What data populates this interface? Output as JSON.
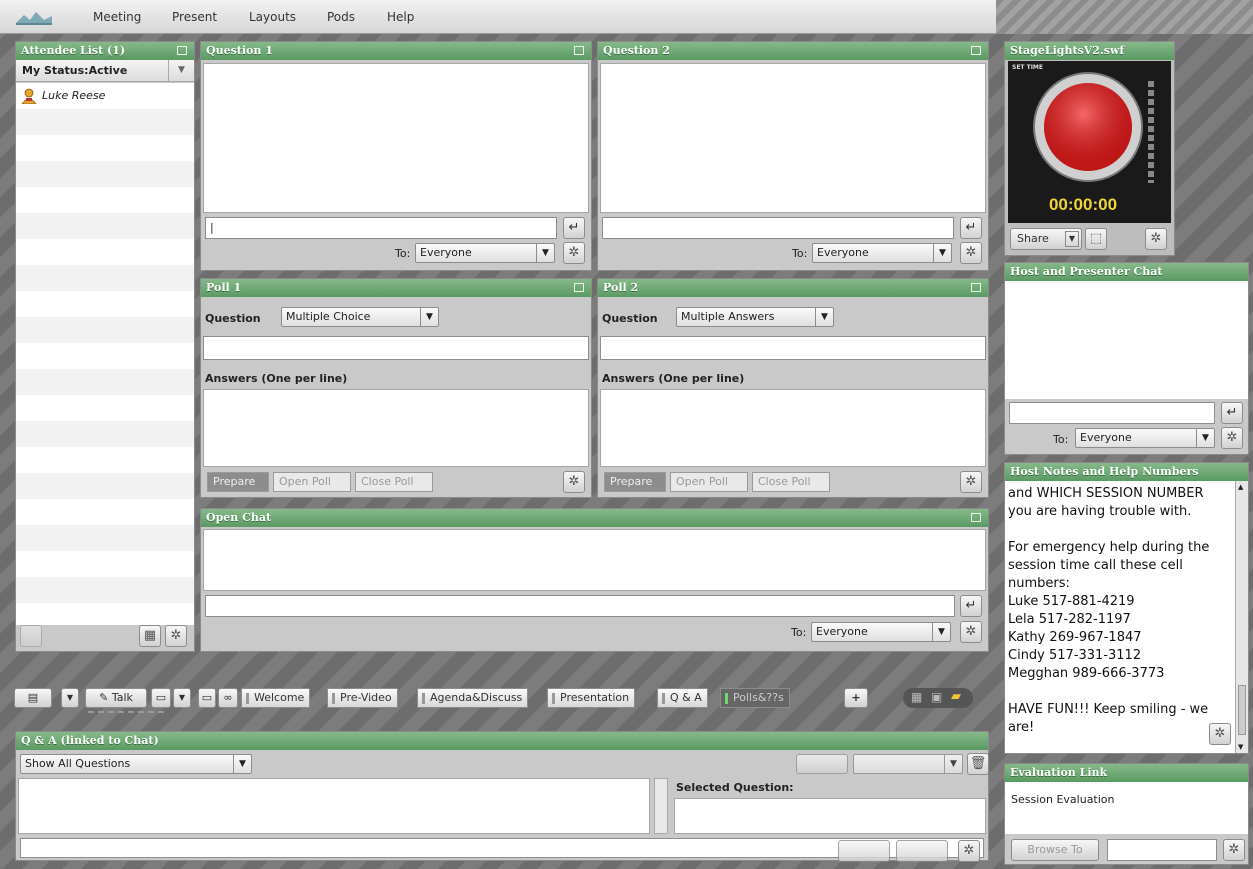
{
  "menu": {
    "items": [
      "Meeting",
      "Present",
      "Layouts",
      "Pods",
      "Help"
    ]
  },
  "attendee_pod": {
    "title": "Attendee List (1)",
    "status_label": "My Status:Active",
    "attendees": [
      "Luke Reese"
    ]
  },
  "question1": {
    "title": "Question 1",
    "to_label": "To:",
    "to_value": "Everyone"
  },
  "question2": {
    "title": "Question 2",
    "to_label": "To:",
    "to_value": "Everyone"
  },
  "poll1": {
    "title": "Poll 1",
    "question_label": "Question",
    "type_value": "Multiple Choice",
    "answers_label": "Answers (One per line)",
    "buttons": [
      "Prepare",
      "Open Poll",
      "Close Poll"
    ]
  },
  "poll2": {
    "title": "Poll 2",
    "question_label": "Question",
    "type_value": "Multiple Answers",
    "answers_label": "Answers (One per line)",
    "buttons": [
      "Prepare",
      "Open Poll",
      "Close Poll"
    ]
  },
  "open_chat": {
    "title": "Open Chat",
    "to_label": "To:",
    "to_value": "Everyone"
  },
  "tabs": {
    "talk_label": "Talk",
    "items": [
      "Welcome",
      "Pre-Video",
      "Agenda&Discuss",
      "Presentation",
      "Q & A",
      "Polls&??s"
    ],
    "add": "+"
  },
  "qa_pod": {
    "title": "Q & A (linked to Chat)",
    "filter_value": "Show All Questions",
    "selected_label": "Selected Question:"
  },
  "stage_pod": {
    "title": "StageLightsV2.swf",
    "set_time": "SET TIME",
    "timer": "00:00:00",
    "share_label": "Share"
  },
  "host_chat": {
    "title": "Host and Presenter Chat",
    "to_label": "To:",
    "to_value": "Everyone"
  },
  "host_notes": {
    "title": "Host Notes and Help Numbers",
    "text": "and WHICH SESSION NUMBER\nyou are having trouble with.\n\nFor emergency help during the\nsession time call these cell\nnumbers:\nLuke 517-881-4219\nLela 517-282-1197\nKathy 269-967-1847\nCindy 517-331-3112\nMegghan 989-666-3773\n\nHAVE FUN!!! Keep smiling - we\nare!"
  },
  "eval_pod": {
    "title": "Evaluation Link",
    "link_text": "Session Evaluation",
    "browse_label": "Browse To"
  },
  "colors": {
    "pod_title_green": "#5a9a63",
    "pod_body_gray": "#c9c9c9",
    "active_tab_indicator": "#6fd86f",
    "timer_red": "#d61f1f",
    "timer_text": "#f1d43a"
  }
}
